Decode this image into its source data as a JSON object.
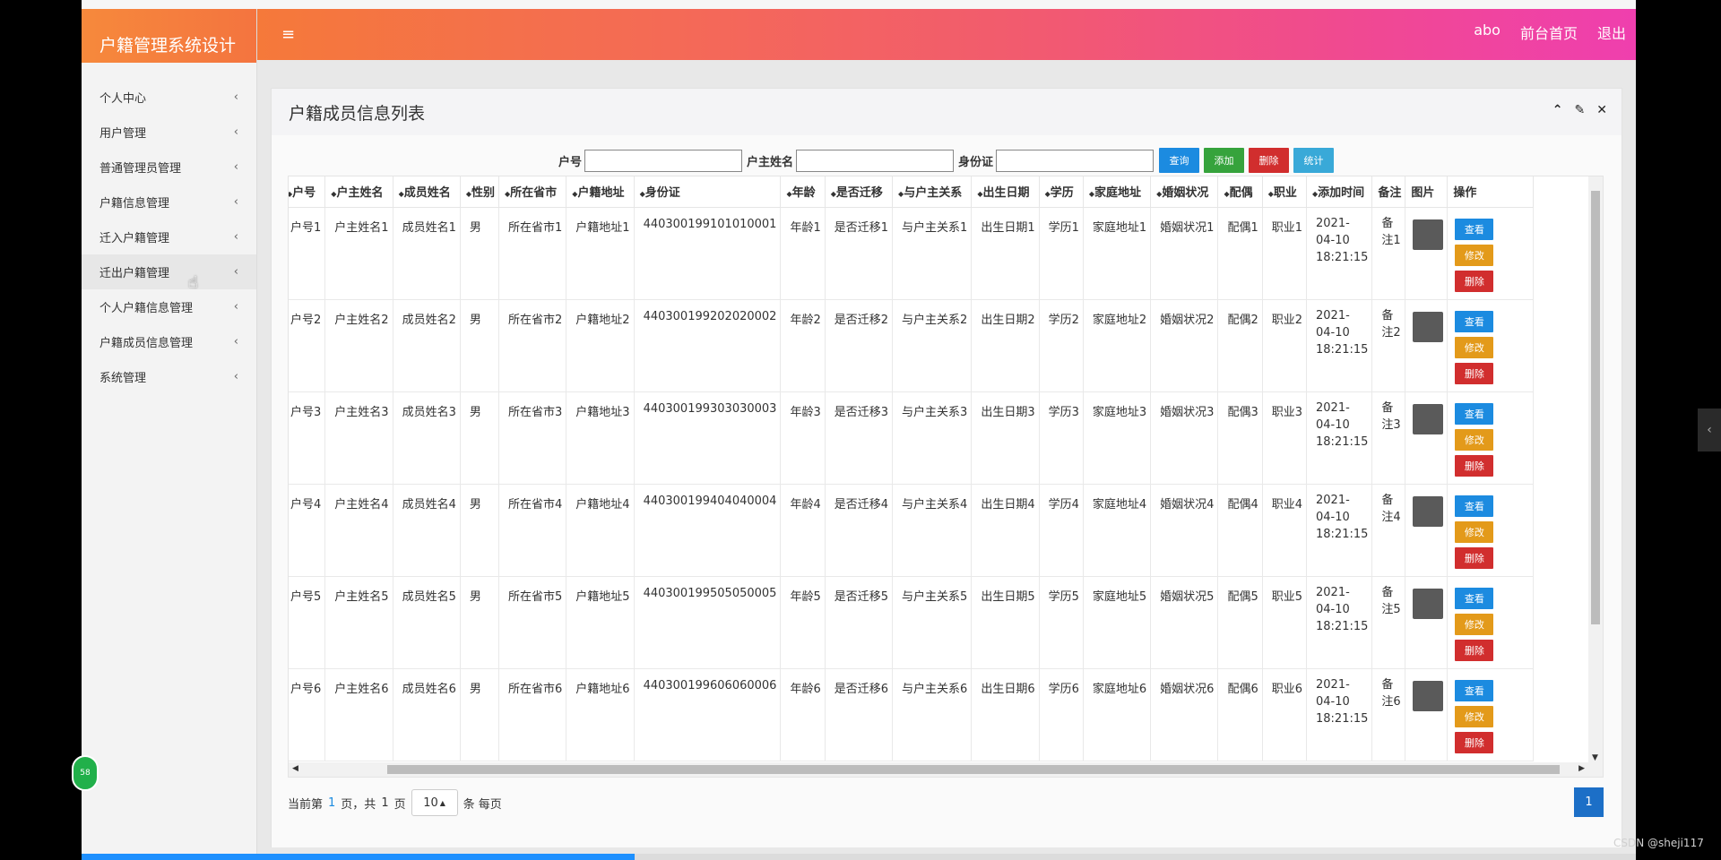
{
  "app": {
    "brand_title": "户籍管理系统设计",
    "menu_icon": "hamburger-icon"
  },
  "header": {
    "user": "abo",
    "home_link": "前台首页",
    "logout_link": "退出"
  },
  "sidebar": {
    "items": [
      {
        "label": "个人中心"
      },
      {
        "label": "用户管理"
      },
      {
        "label": "普通管理员管理"
      },
      {
        "label": "户籍信息管理"
      },
      {
        "label": "迁入户籍管理"
      },
      {
        "label": "迁出户籍管理"
      },
      {
        "label": "个人户籍信息管理"
      },
      {
        "label": "户籍成员信息管理"
      },
      {
        "label": "系统管理"
      }
    ]
  },
  "panel": {
    "title": "户籍成员信息列表"
  },
  "search": {
    "hukou_label": "户号",
    "owner_label": "户主姓名",
    "id_label": "身份证",
    "query": "查询",
    "add": "添加",
    "delete": "删除",
    "stats": "统计"
  },
  "table": {
    "headers": [
      "户号",
      "户主姓名",
      "成员姓名",
      "性别",
      "所在省市",
      "户籍地址",
      "身份证",
      "年龄",
      "是否迁移",
      "与户主关系",
      "出生日期",
      "学历",
      "家庭地址",
      "婚姻状况",
      "配偶",
      "职业",
      "添加时间",
      "备注",
      "图片",
      "操作"
    ],
    "sort_marker": "◆",
    "rows": [
      {
        "hukou": "户号1",
        "owner": "户主姓名1",
        "member": "成员姓名1",
        "gender": "男",
        "province": "所在省市1",
        "addr": "户籍地址1",
        "id": "440300199101010001",
        "age": "年龄1",
        "migrate": "是否迁移1",
        "relation": "与户主关系1",
        "birth": "出生日期1",
        "edu": "学历1",
        "home": "家庭地址1",
        "marital": "婚姻状况1",
        "spouse": "配偶1",
        "job": "职业1",
        "added": "2021-04-10 18:21:15",
        "note": "备注1"
      },
      {
        "hukou": "户号2",
        "owner": "户主姓名2",
        "member": "成员姓名2",
        "gender": "男",
        "province": "所在省市2",
        "addr": "户籍地址2",
        "id": "440300199202020002",
        "age": "年龄2",
        "migrate": "是否迁移2",
        "relation": "与户主关系2",
        "birth": "出生日期2",
        "edu": "学历2",
        "home": "家庭地址2",
        "marital": "婚姻状况2",
        "spouse": "配偶2",
        "job": "职业2",
        "added": "2021-04-10 18:21:15",
        "note": "备注2"
      },
      {
        "hukou": "户号3",
        "owner": "户主姓名3",
        "member": "成员姓名3",
        "gender": "男",
        "province": "所在省市3",
        "addr": "户籍地址3",
        "id": "440300199303030003",
        "age": "年龄3",
        "migrate": "是否迁移3",
        "relation": "与户主关系3",
        "birth": "出生日期3",
        "edu": "学历3",
        "home": "家庭地址3",
        "marital": "婚姻状况3",
        "spouse": "配偶3",
        "job": "职业3",
        "added": "2021-04-10 18:21:15",
        "note": "备注3"
      },
      {
        "hukou": "户号4",
        "owner": "户主姓名4",
        "member": "成员姓名4",
        "gender": "男",
        "province": "所在省市4",
        "addr": "户籍地址4",
        "id": "440300199404040004",
        "age": "年龄4",
        "migrate": "是否迁移4",
        "relation": "与户主关系4",
        "birth": "出生日期4",
        "edu": "学历4",
        "home": "家庭地址4",
        "marital": "婚姻状况4",
        "spouse": "配偶4",
        "job": "职业4",
        "added": "2021-04-10 18:21:15",
        "note": "备注4"
      },
      {
        "hukou": "户号5",
        "owner": "户主姓名5",
        "member": "成员姓名5",
        "gender": "男",
        "province": "所在省市5",
        "addr": "户籍地址5",
        "id": "440300199505050005",
        "age": "年龄5",
        "migrate": "是否迁移5",
        "relation": "与户主关系5",
        "birth": "出生日期5",
        "edu": "学历5",
        "home": "家庭地址5",
        "marital": "婚姻状况5",
        "spouse": "配偶5",
        "job": "职业5",
        "added": "2021-04-10 18:21:15",
        "note": "备注5"
      },
      {
        "hukou": "户号6",
        "owner": "户主姓名6",
        "member": "成员姓名6",
        "gender": "男",
        "province": "所在省市6",
        "addr": "户籍地址6",
        "id": "440300199606060006",
        "age": "年龄6",
        "migrate": "是否迁移6",
        "relation": "与户主关系6",
        "birth": "出生日期6",
        "edu": "学历6",
        "home": "家庭地址6",
        "marital": "婚姻状况6",
        "spouse": "配偶6",
        "job": "职业6",
        "added": "2021-04-10 18:21:15",
        "note": "备注6"
      }
    ],
    "row_actions": {
      "view": "查看",
      "edit": "修改",
      "delete": "删除"
    }
  },
  "pager": {
    "text_prefix": "当前第",
    "current": "1",
    "text_mid": "页，共",
    "total": "1",
    "text_suffix": "页",
    "page_size": "10",
    "per_page_text": "条 每页",
    "page_button": "1"
  },
  "overlay": {
    "badge": "58",
    "watermark": "CSDN @sheji117"
  },
  "colors": {
    "accent_blue": "#1c8be0",
    "green": "#36a33c",
    "red": "#d12e2e",
    "orange": "#e39a1a",
    "header_start": "#f5793a",
    "header_end": "#ef3fae"
  }
}
